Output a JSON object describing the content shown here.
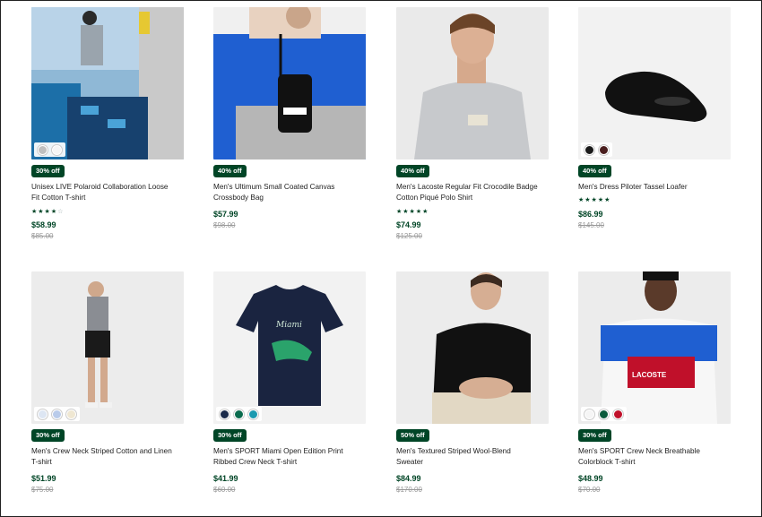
{
  "products": [
    {
      "badge": "30% off",
      "name_line1": "Unisex LIVE Polaroid Collaboration Loose",
      "name_line2": "Fit Cotton T-shirt",
      "rating": 4,
      "price": "$58.99",
      "original_price": "$85.00",
      "swatches": [
        "#bfbfbf",
        "#f5f5f5"
      ]
    },
    {
      "badge": "40% off",
      "name_line1": "Men's Ultimum Small Coated Canvas",
      "name_line2": "Crossbody Bag",
      "rating": 0,
      "price": "$57.99",
      "original_price": "$98.00",
      "swatches": []
    },
    {
      "badge": "40% off",
      "name_line1": "Men's Lacoste Regular Fit Crocodile Badge",
      "name_line2": "Cotton Piqué Polo Shirt",
      "rating": 5,
      "price": "$74.99",
      "original_price": "$125.00",
      "swatches": []
    },
    {
      "badge": "40% off",
      "name_line1": "Men's Dress Piloter Tassel Loafer",
      "name_line2": "",
      "rating": 5,
      "price": "$86.99",
      "original_price": "$145.00",
      "swatches": [
        "#1a1a1a",
        "#4a1f1f"
      ]
    },
    {
      "badge": "30% off",
      "name_line1": "Men's Crew Neck Striped Cotton and Linen",
      "name_line2": "T-shirt",
      "rating": 0,
      "price": "$51.99",
      "original_price": "$75.00",
      "swatches": [
        "#dde6f3",
        "#b9cbea",
        "#efe7d2"
      ]
    },
    {
      "badge": "30% off",
      "name_line1": "Men's SPORT Miami Open Edition Print",
      "name_line2": "Ribbed Crew Neck T-shirt",
      "rating": 0,
      "price": "$41.99",
      "original_price": "$60.00",
      "swatches": [
        "#1a2a4a",
        "#0b6b4e",
        "#1b9ab0"
      ]
    },
    {
      "badge": "50% off",
      "name_line1": "Men's Textured Striped Wool-Blend",
      "name_line2": "Sweater",
      "rating": 0,
      "price": "$84.99",
      "original_price": "$170.00",
      "swatches": []
    },
    {
      "badge": "30% off",
      "name_line1": "Men's SPORT Crew Neck Breathable",
      "name_line2": "Colorblock T-shirt",
      "rating": 0,
      "price": "$48.99",
      "original_price": "$70.00",
      "swatches": [
        "#f5f5f5",
        "#0b5b3c",
        "#c0102a"
      ]
    }
  ]
}
